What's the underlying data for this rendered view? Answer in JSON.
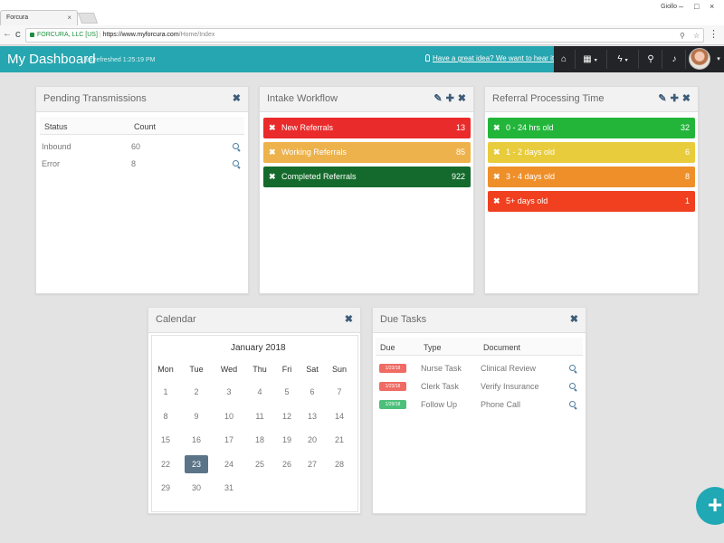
{
  "browser": {
    "tab_title": "Forcura",
    "tab_close": "×",
    "user_name": "Giollo",
    "win_min": "–",
    "win_max": "□",
    "win_close": "×",
    "back": "←",
    "forward": "→",
    "reload": "C",
    "site_identity": "FORCURA, LLC [US]",
    "url_host": "https://www.myforcura.com",
    "url_path": "/Home/Index",
    "menu": "⋮"
  },
  "header": {
    "title": "My Dashboard",
    "last_refreshed": "Last refreshed 1:25:19 PM",
    "idea_link": "Have a great idea? We want to hear it!",
    "caret": "▾"
  },
  "pending": {
    "title": "Pending Transmissions",
    "close": "✖",
    "columns": [
      "Status",
      "Count"
    ],
    "rows": [
      {
        "status": "Inbound",
        "count": "60"
      },
      {
        "status": "Error",
        "count": "8"
      }
    ]
  },
  "intake": {
    "title": "Intake Workflow",
    "edit": "✎",
    "add": "✚",
    "close": "✖",
    "rows": [
      {
        "label": "New Referrals",
        "count": "13",
        "color": "#ea2b2b"
      },
      {
        "label": "Working Referrals",
        "count": "85",
        "color": "#edb24c"
      },
      {
        "label": "Completed Referrals",
        "count": "922",
        "color": "#146a2c"
      }
    ]
  },
  "referral_time": {
    "title": "Referral Processing Time",
    "edit": "✎",
    "add": "✚",
    "close": "✖",
    "rows": [
      {
        "label": "0 - 24 hrs old",
        "count": "32",
        "color": "#22b53a"
      },
      {
        "label": "1 - 2 days old",
        "count": "6",
        "color": "#e8cc3c"
      },
      {
        "label": "3 - 4 days old",
        "count": "8",
        "color": "#ef8f2a"
      },
      {
        "label": "5+ days old",
        "count": "1",
        "color": "#f0401f"
      }
    ]
  },
  "calendar": {
    "title": "Calendar",
    "close": "✖",
    "month": "January 2018",
    "dow": [
      "Mon",
      "Tue",
      "Wed",
      "Thu",
      "Fri",
      "Sat",
      "Sun"
    ],
    "weeks": [
      [
        "1",
        "2",
        "3",
        "4",
        "5",
        "6",
        "7"
      ],
      [
        "8",
        "9",
        "10",
        "11",
        "12",
        "13",
        "14"
      ],
      [
        "15",
        "16",
        "17",
        "18",
        "19",
        "20",
        "21"
      ],
      [
        "22",
        "23",
        "24",
        "25",
        "26",
        "27",
        "28"
      ],
      [
        "29",
        "30",
        "31",
        "",
        "",
        "",
        ""
      ]
    ],
    "today": "23"
  },
  "due_tasks": {
    "title": "Due Tasks",
    "close": "✖",
    "columns": [
      "Due",
      "Type",
      "Document"
    ],
    "rows": [
      {
        "due": "1/23/18",
        "type": "Nurse Task",
        "document": "Clinical Review",
        "color": "#ef6b63"
      },
      {
        "due": "1/23/18",
        "type": "Clerk Task",
        "document": "Verify Insurance",
        "color": "#ef6b63"
      },
      {
        "due": "1/29/18",
        "type": "Follow Up",
        "document": "Phone Call",
        "color": "#4cc07a"
      }
    ]
  },
  "fab": {
    "label": "+"
  },
  "icons": {
    "close": "✖",
    "x": "✖",
    "home": "⌂",
    "grid": "▦",
    "bolt": "ϟ",
    "search": "⚲",
    "bell": "♪",
    "star": "☆",
    "caret": "▾"
  },
  "colors": {
    "accent": "#26a6b0",
    "dark_bar": "#222428"
  }
}
